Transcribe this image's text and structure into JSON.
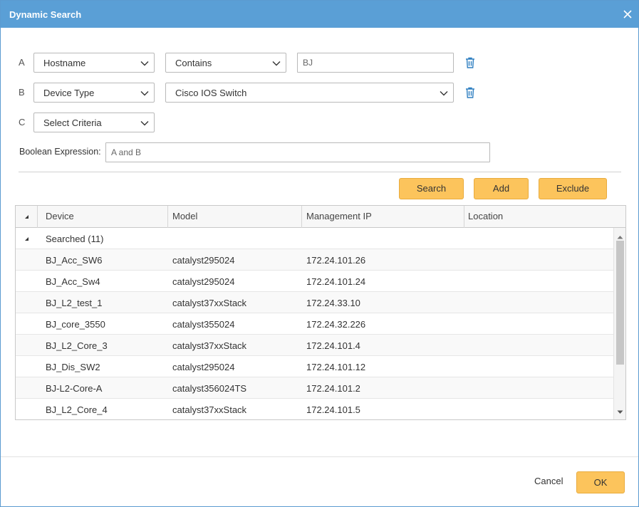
{
  "dialog": {
    "title": "Dynamic Search"
  },
  "criteria": [
    {
      "letter": "A",
      "field": "Hostname",
      "operator": "Contains",
      "value": "BJ"
    },
    {
      "letter": "B",
      "field": "Device Type",
      "value": "Cisco IOS Switch"
    },
    {
      "letter": "C",
      "field": "Select Criteria"
    }
  ],
  "boolean": {
    "label": "Boolean Expression:",
    "value": "A and B"
  },
  "actions": {
    "search": "Search",
    "add": "Add",
    "exclude": "Exclude"
  },
  "table": {
    "columns": [
      "Device",
      "Model",
      "Management IP",
      "Location"
    ],
    "group_label": "Searched (11)",
    "rows": [
      {
        "device": "BJ_Acc_SW6",
        "model": "catalyst295024",
        "ip": "172.24.101.26",
        "location": ""
      },
      {
        "device": "BJ_Acc_Sw4",
        "model": "catalyst295024",
        "ip": "172.24.101.24",
        "location": ""
      },
      {
        "device": "BJ_L2_test_1",
        "model": "catalyst37xxStack",
        "ip": "172.24.33.10",
        "location": ""
      },
      {
        "device": "BJ_core_3550",
        "model": "catalyst355024",
        "ip": "172.24.32.226",
        "location": ""
      },
      {
        "device": "BJ_L2_Core_3",
        "model": "catalyst37xxStack",
        "ip": "172.24.101.4",
        "location": ""
      },
      {
        "device": "BJ_Dis_SW2",
        "model": "catalyst295024",
        "ip": "172.24.101.12",
        "location": ""
      },
      {
        "device": "BJ-L2-Core-A",
        "model": "catalyst356024TS",
        "ip": "172.24.101.2",
        "location": ""
      },
      {
        "device": "BJ_L2_Core_4",
        "model": "catalyst37xxStack",
        "ip": "172.24.101.5",
        "location": ""
      }
    ]
  },
  "footer": {
    "cancel": "Cancel",
    "ok": "OK"
  },
  "colors": {
    "titlebar": "#5a9fd6",
    "button": "#fcc45c",
    "trash": "#2f7fc1"
  }
}
